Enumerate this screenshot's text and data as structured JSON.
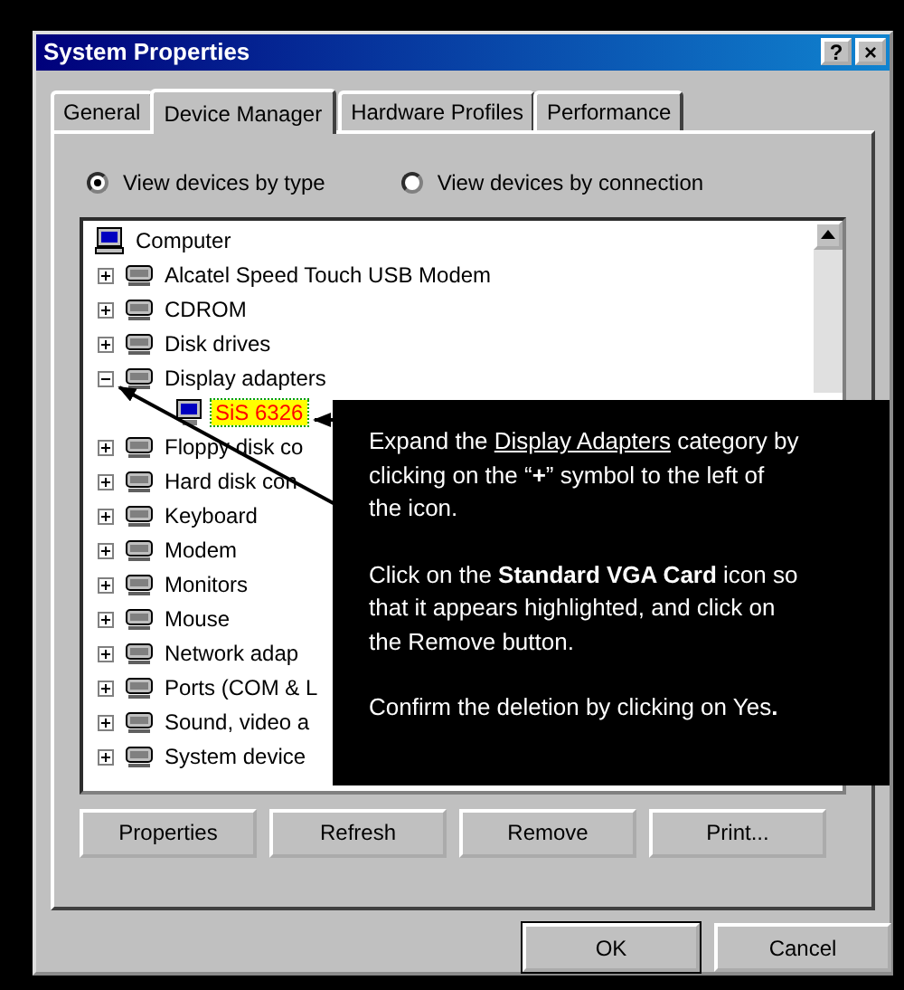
{
  "window": {
    "title": "System Properties",
    "help_button": "?",
    "close_button": "×"
  },
  "tabs": [
    {
      "label": "General",
      "selected": false
    },
    {
      "label": "Device Manager",
      "selected": true
    },
    {
      "label": "Hardware Profiles",
      "selected": false
    },
    {
      "label": "Performance",
      "selected": false
    }
  ],
  "view_options": [
    {
      "label": "View devices by type",
      "selected": true
    },
    {
      "label": "View devices by connection",
      "selected": false
    }
  ],
  "tree": {
    "label": "Computer",
    "children": [
      {
        "label": "Alcatel Speed Touch USB Modem",
        "expanded": false
      },
      {
        "label": "CDROM",
        "expanded": false
      },
      {
        "label": "Disk drives",
        "expanded": false
      },
      {
        "label": "Display adapters",
        "expanded": true,
        "children": [
          {
            "label": "SiS 6326",
            "selected": true
          }
        ]
      },
      {
        "label": "Floppy disk co",
        "expanded": false
      },
      {
        "label": "Hard disk con",
        "expanded": false
      },
      {
        "label": "Keyboard",
        "expanded": false
      },
      {
        "label": "Modem",
        "expanded": false
      },
      {
        "label": "Monitors",
        "expanded": false
      },
      {
        "label": "Mouse",
        "expanded": false
      },
      {
        "label": "Network adap",
        "expanded": false
      },
      {
        "label": "Ports (COM & L",
        "expanded": false
      },
      {
        "label": "Sound, video a",
        "expanded": false
      },
      {
        "label": "System device",
        "expanded": false
      }
    ]
  },
  "callout": {
    "paragraphs": [
      {
        "before": "Expand the ",
        "link": "Display Adapters",
        "after": " category by clicking on the “**+**” symbol to the left of the icon."
      },
      {
        "before": "Click on the **Standard VGA Card** icon so that it appears highlighted, and click on the Remove button."
      },
      {
        "before": "Confirm the deletion by clicking on Yes**.**"
      }
    ]
  },
  "device_buttons": [
    "Properties",
    "Refresh",
    "Remove",
    "Print..."
  ],
  "dialog_buttons": [
    "OK",
    "Cancel"
  ]
}
